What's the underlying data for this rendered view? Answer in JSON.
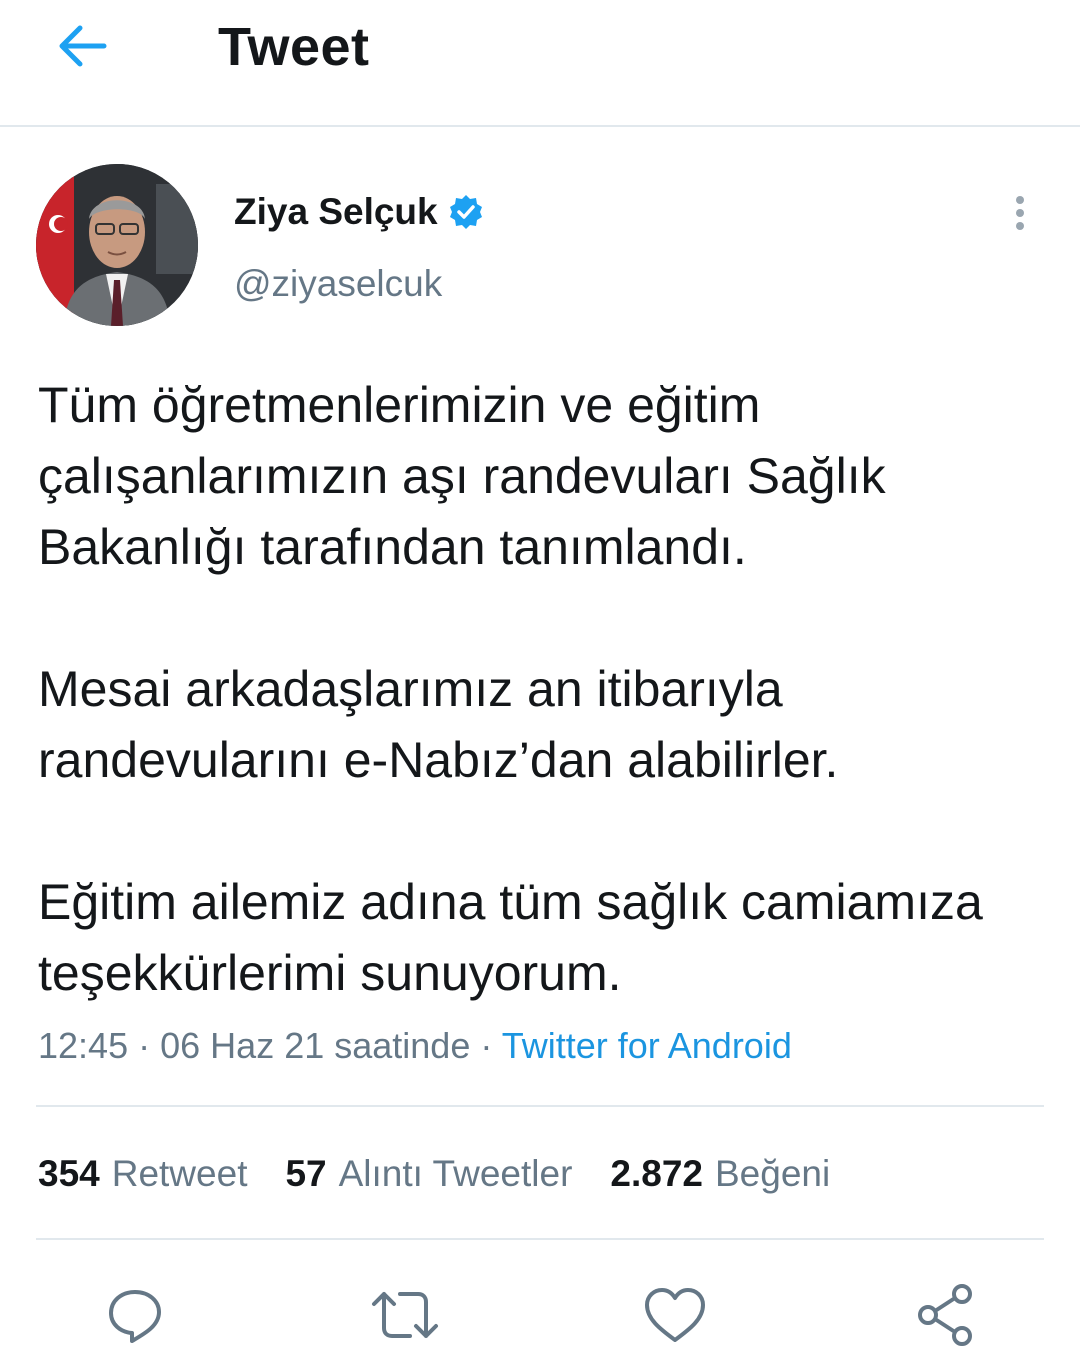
{
  "header": {
    "title": "Tweet"
  },
  "author": {
    "name": "Ziya Selçuk",
    "handle": "@ziyaselcuk",
    "verified": true
  },
  "tweet": {
    "paragraphs": [
      "Tüm öğretmenlerimizin ve eğitim çalışanlarımızın aşı randevuları Sağlık Bakanlığı tarafından tanımlandı.",
      "Mesai arkadaşlarımız an itibarıyla randevularını e-Nabız’dan alabilirler.",
      "Eğitim ailemiz adına tüm sağlık camiamıza teşekkürlerimi sunuyorum."
    ],
    "time": "12:45",
    "date": "06 Haz 21 saatinde",
    "separator": "·",
    "source": "Twitter for Android"
  },
  "stats": {
    "retweets": {
      "count": "354",
      "label": "Retweet"
    },
    "quotes": {
      "count": "57",
      "label": "Alıntı Tweetler"
    },
    "likes": {
      "count": "2.872",
      "label": "Beğeni"
    }
  },
  "icons": {
    "back": "arrow-left-icon",
    "verified": "verified-badge-icon",
    "more": "more-vertical-icon",
    "reply": "reply-icon",
    "retweet": "retweet-icon",
    "like": "heart-icon",
    "share": "share-icon"
  },
  "colors": {
    "accent": "#1da1f2",
    "link": "#1b95e0",
    "secondary_text": "#657786",
    "divider": "#e1e8ed"
  }
}
